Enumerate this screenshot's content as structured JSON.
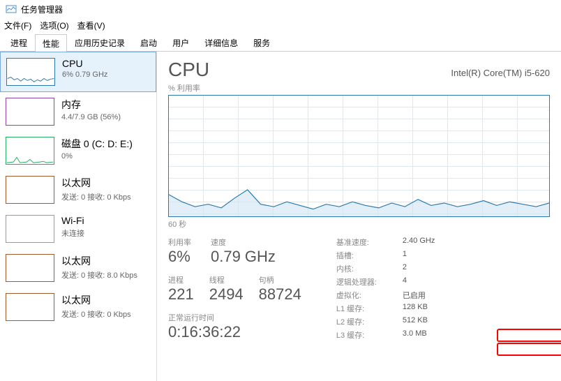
{
  "window": {
    "title": "任务管理器"
  },
  "menus": {
    "file": "文件(F)",
    "options": "选项(O)",
    "view": "查看(V)"
  },
  "tabs": [
    "进程",
    "性能",
    "应用历史记录",
    "启动",
    "用户",
    "详细信息",
    "服务"
  ],
  "active_tab": 1,
  "sidebar": [
    {
      "title": "CPU",
      "sub": "6% 0.79 GHz",
      "color": "#2a7ab0",
      "spark": "0,30 5,28 10,32 15,30 20,34 25,30 30,33 35,31 40,35 45,32 50,34 55,30 60,33 65,31 70,30"
    },
    {
      "title": "内存",
      "sub": "4.4/7.9 GB (56%)",
      "color": "#8e44ad",
      "spark": ""
    },
    {
      "title": "磁盘 0 (C: D: E:)",
      "sub": "0%",
      "color": "#27ae60",
      "spark": "0,38 10,37 15,30 20,38 30,37 35,33 40,38 50,37 55,36 60,38 70,37"
    },
    {
      "title": "以太网",
      "sub": "发送: 0 接收: 0 Kbps",
      "color": "#a05a2c",
      "spark": ""
    },
    {
      "title": "Wi-Fi",
      "sub": "未连接",
      "color": "#999",
      "spark": ""
    },
    {
      "title": "以太网",
      "sub": "发送: 0 接收: 8.0 Kbps",
      "color": "#a05a2c",
      "spark": ""
    },
    {
      "title": "以太网",
      "sub": "发送: 0 接收: 0 Kbps",
      "color": "#a05a2c",
      "spark": ""
    }
  ],
  "main": {
    "title": "CPU",
    "subtitle": "Intel(R) Core(TM) i5-620",
    "chart_top_label": "% 利用率",
    "chart_bottom_label": "60 秒",
    "stats_col1": {
      "util_label": "利用率",
      "util_value": "6%",
      "proc_label": "进程",
      "proc_value": "221"
    },
    "stats_col2": {
      "speed_label": "速度",
      "speed_value": "0.79 GHz",
      "threads_label": "线程",
      "threads_value": "2494"
    },
    "stats_col3": {
      "handles_label": "句柄",
      "handles_value": "88724"
    },
    "uptime": {
      "label": "正常运行时间",
      "value": "0:16:36:22"
    },
    "right": [
      {
        "k": "基准速度:",
        "v": "2.40 GHz"
      },
      {
        "k": "插槽:",
        "v": "1"
      },
      {
        "k": "内核:",
        "v": "2"
      },
      {
        "k": "逻辑处理器:",
        "v": "4"
      },
      {
        "k": "虚拟化:",
        "v": "已启用"
      },
      {
        "k": "L1 缓存:",
        "v": "128 KB"
      },
      {
        "k": "L2 缓存:",
        "v": "512 KB"
      },
      {
        "k": "L3 缓存:",
        "v": "3.0 MB"
      }
    ]
  },
  "chart_data": {
    "type": "line",
    "title": "% 利用率",
    "xlabel": "60 秒",
    "ylabel": "",
    "ylim": [
      0,
      100
    ],
    "x": [
      0,
      5,
      10,
      15,
      20,
      25,
      30,
      35,
      40,
      45,
      50,
      55,
      60,
      65,
      70,
      75,
      80,
      85,
      90,
      95,
      100,
      105,
      110,
      115,
      120,
      125,
      130,
      135,
      140,
      145
    ],
    "values": [
      18,
      12,
      8,
      10,
      7,
      15,
      22,
      10,
      8,
      12,
      9,
      6,
      10,
      8,
      12,
      9,
      7,
      11,
      8,
      14,
      9,
      11,
      8,
      10,
      13,
      9,
      12,
      10,
      8,
      11
    ]
  }
}
